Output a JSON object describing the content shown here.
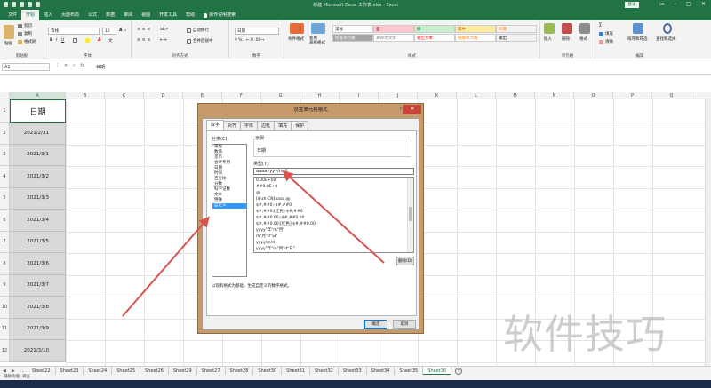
{
  "window": {
    "title": "新建 Microsoft Excel 工作表.xlsx  -  Excel",
    "login": "登录"
  },
  "ribbon_tabs": [
    "文件",
    "开始",
    "插入",
    "页面布局",
    "公式",
    "数据",
    "审阅",
    "视图",
    "开发工具",
    "帮助",
    "操作说明搜索"
  ],
  "active_ribbon_tab": "开始",
  "ribbon": {
    "clipboard": {
      "label": "剪贴板",
      "cut": "剪切",
      "copy": "复制",
      "painter": "格式刷",
      "paste": "粘贴"
    },
    "font": {
      "label": "字体",
      "name": "等线",
      "size": "12"
    },
    "align": {
      "label": "对齐方式",
      "wrap": "自动换行",
      "merge": "合并后居中"
    },
    "number": {
      "label": "数字",
      "format": "日期"
    },
    "styles": {
      "label": "样式",
      "cond": "条件格式",
      "table": "套用\n表格格式",
      "cells": [
        "常规",
        "差",
        "好",
        "适中",
        "计算",
        "检查单元格",
        "解释性文本",
        "警告文本",
        "链接单元格",
        "输出"
      ]
    },
    "cells": {
      "label": "单元格",
      "insert": "插入",
      "delete": "删除",
      "format": "格式"
    },
    "editing": {
      "label": "编辑",
      "sum": "∑",
      "fill": "填充",
      "clear": "清除",
      "sort": "排序和筛选",
      "find": "查找和选择"
    }
  },
  "formula_bar": {
    "name_box": "A1",
    "value": "日期"
  },
  "columns": [
    "A",
    "B",
    "C",
    "D",
    "E",
    "F",
    "G",
    "H",
    "I",
    "J",
    "K",
    "L",
    "M",
    "N",
    "O",
    "P",
    "Q"
  ],
  "rows": [
    {
      "n": "1",
      "a": "日期"
    },
    {
      "n": "2",
      "a": "2021/2/31"
    },
    {
      "n": "3",
      "a": "2021/3/1"
    },
    {
      "n": "4",
      "a": "2021/3/2"
    },
    {
      "n": "5",
      "a": "2021/3/3"
    },
    {
      "n": "6",
      "a": "2021/3/4"
    },
    {
      "n": "7",
      "a": "2021/3/5"
    },
    {
      "n": "8",
      "a": "2021/3/6"
    },
    {
      "n": "9",
      "a": "2021/3/7"
    },
    {
      "n": "10",
      "a": "2021/3/8"
    },
    {
      "n": "11",
      "a": "2021/3/9"
    },
    {
      "n": "12",
      "a": "2021/3/10"
    }
  ],
  "sheet_tabs": [
    "Sheet22",
    "Sheet23",
    "Sheet24",
    "Sheet25",
    "Sheet26",
    "Sheet29",
    "Sheet27",
    "Sheet28",
    "Sheet30",
    "Sheet31",
    "Sheet32",
    "Sheet33",
    "Sheet34",
    "Sheet35",
    "Sheet36"
  ],
  "active_sheet": "Sheet36",
  "status_bar": "辅助功能: 调查",
  "dialog": {
    "title": "设置单元格格式",
    "help": "?",
    "close": "✕",
    "tabs": [
      "数字",
      "对齐",
      "字体",
      "边框",
      "填充",
      "保护"
    ],
    "active_tab": "数字",
    "category_label": "分类(C):",
    "categories": [
      "常规",
      "数值",
      "货币",
      "会计专用",
      "日期",
      "时间",
      "百分比",
      "分数",
      "科学记数",
      "文本",
      "特殊",
      "自定义"
    ],
    "selected_category": "自定义",
    "sample_label": "示例",
    "sample_value": "日期",
    "type_label": "类型(T):",
    "type_value": "aaaayyyy/m/d",
    "formats": [
      "0.00E+00",
      "##0.0E+0",
      "@",
      "[$-zh-CN]aaaa;@",
      "$#,##0;-$#,##0",
      "$#,##0;[红色]-$#,##0",
      "$#,##0.00;-$#,##0.00",
      "$#,##0.00;[红色]-$#,##0.00",
      "yyyy\"年\"m\"月\"",
      "m\"月\"d\"日\"",
      "yyyy/m/d",
      "yyyy\"年\"m\"月\"d\"日\"",
      "m/d/yy",
      "d-mmm-yy",
      "d-mmm",
      "mmm-yy"
    ],
    "selected_format": "",
    "delete_button": "删除(D)",
    "description": "以现有格式为基础，生成自定义的数字格式。",
    "ok": "确定",
    "cancel": "取消"
  },
  "watermark": "软件技巧"
}
